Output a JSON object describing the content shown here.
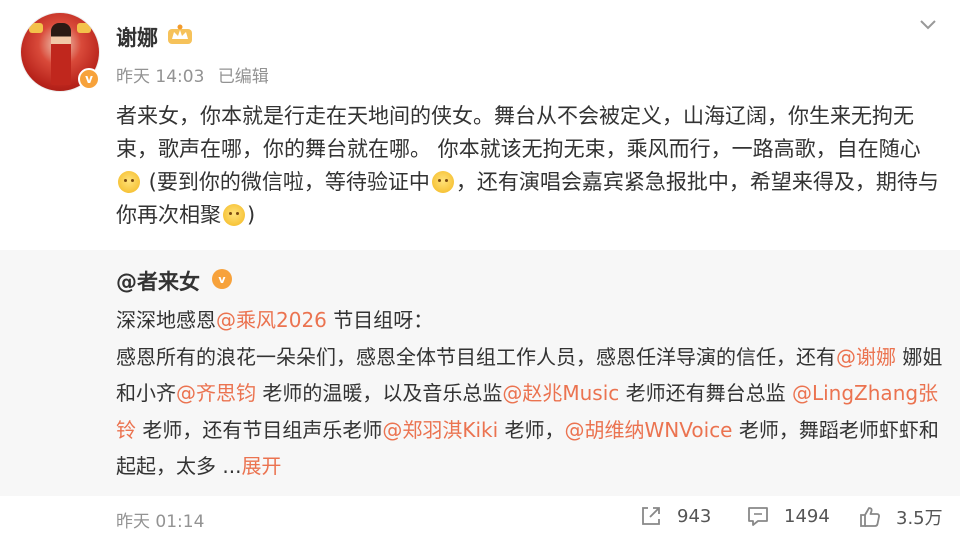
{
  "post": {
    "username": "谢娜",
    "time": "昨天 14:03",
    "edited": "已编辑",
    "text_parts": {
      "p1": "者来女，你本就是行走在天地间的侠女。舞台从不会被定义，山海辽阔，你生来无拘无束，歌声在哪，你的舞台就在哪。 你本就该无拘无束，乘风而行，一路高歌，自在随心",
      "p2": " (要到你的微信啦，等待验证中",
      "p3": "，还有演唱会嘉宾紧急报批中，希望来得及，期待与你再次相聚",
      "p4": ")"
    }
  },
  "quote": {
    "author": "@者来女",
    "line1_a": "深深地感恩",
    "line1_mention": "@乘风2026",
    "line1_b": " 节目组呀：",
    "l2_a": "感恩所有的浪花一朵朵们，感恩全体节目组工作人员，感恩任洋导演的信任，还有",
    "m_xiena": "@谢娜",
    "l3_a": " 娜姐和小齐",
    "m_qi": "@齐思钧",
    "l3_b": " 老师的温暖，以及音乐总监",
    "m_zhao": "@赵兆Music",
    "l3_c": " 老师还有舞台总监",
    "m_ling": "@LingZhang张铃",
    "l4_a": " 老师，还有节目组声乐老师",
    "m_zheng": "@郑羽淇Kiki",
    "l4_b": " 老师，",
    "m_hu": "@胡维纳WNVoice",
    "l5_a": "老师，舞蹈老师虾虾和起起，太多 ",
    "ellipsis": "...",
    "expand": "展开",
    "time": "昨天 01:14"
  },
  "actions": {
    "share_count": "943",
    "comment_count": "1494",
    "like_count": "3.5万"
  },
  "icons": {
    "more": "chevron-down-icon",
    "share": "share-icon",
    "comment": "comment-icon",
    "like": "thumbs-up-icon",
    "crown": "crown-badge-icon"
  },
  "colors": {
    "mention": "#eb7350",
    "meta": "#939393",
    "quote_bg": "#f7f7f7",
    "vip": "#f7a23b"
  }
}
